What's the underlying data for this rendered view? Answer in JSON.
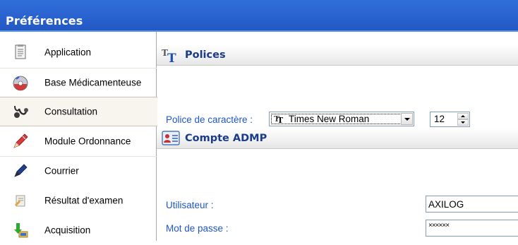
{
  "window": {
    "title": "Préférences"
  },
  "sidebar": {
    "items": [
      {
        "label": "Application",
        "icon": "document-icon",
        "selected": false
      },
      {
        "label": "Base Médicamenteuse",
        "icon": "disc-icon",
        "selected": false
      },
      {
        "label": "Consultation",
        "icon": "stethoscope-icon",
        "selected": true
      },
      {
        "label": "Module Ordonnance",
        "icon": "pencil-icon",
        "selected": false
      },
      {
        "label": "Courrier",
        "icon": "pen-icon",
        "selected": false
      },
      {
        "label": "Résultat d'examen",
        "icon": "test-result-icon",
        "selected": false
      },
      {
        "label": "Acquisition",
        "icon": "download-icon",
        "selected": false
      }
    ]
  },
  "fonts_section": {
    "title": "Polices",
    "icon": "font-icon",
    "font_label": "Police de caractère :",
    "font_value": "Times New Roman",
    "size_value": "12"
  },
  "admp_section": {
    "title": "Compte ADMP",
    "icon": "user-card-icon",
    "user_label": "Utilisateur :",
    "user_value": "AXILOG",
    "password_label": "Mot de passe :",
    "password_value": "××××××"
  },
  "colors": {
    "titlebar": "#2c66d2",
    "label_blue": "#1f55c8",
    "section_title": "#1a3a8a"
  }
}
